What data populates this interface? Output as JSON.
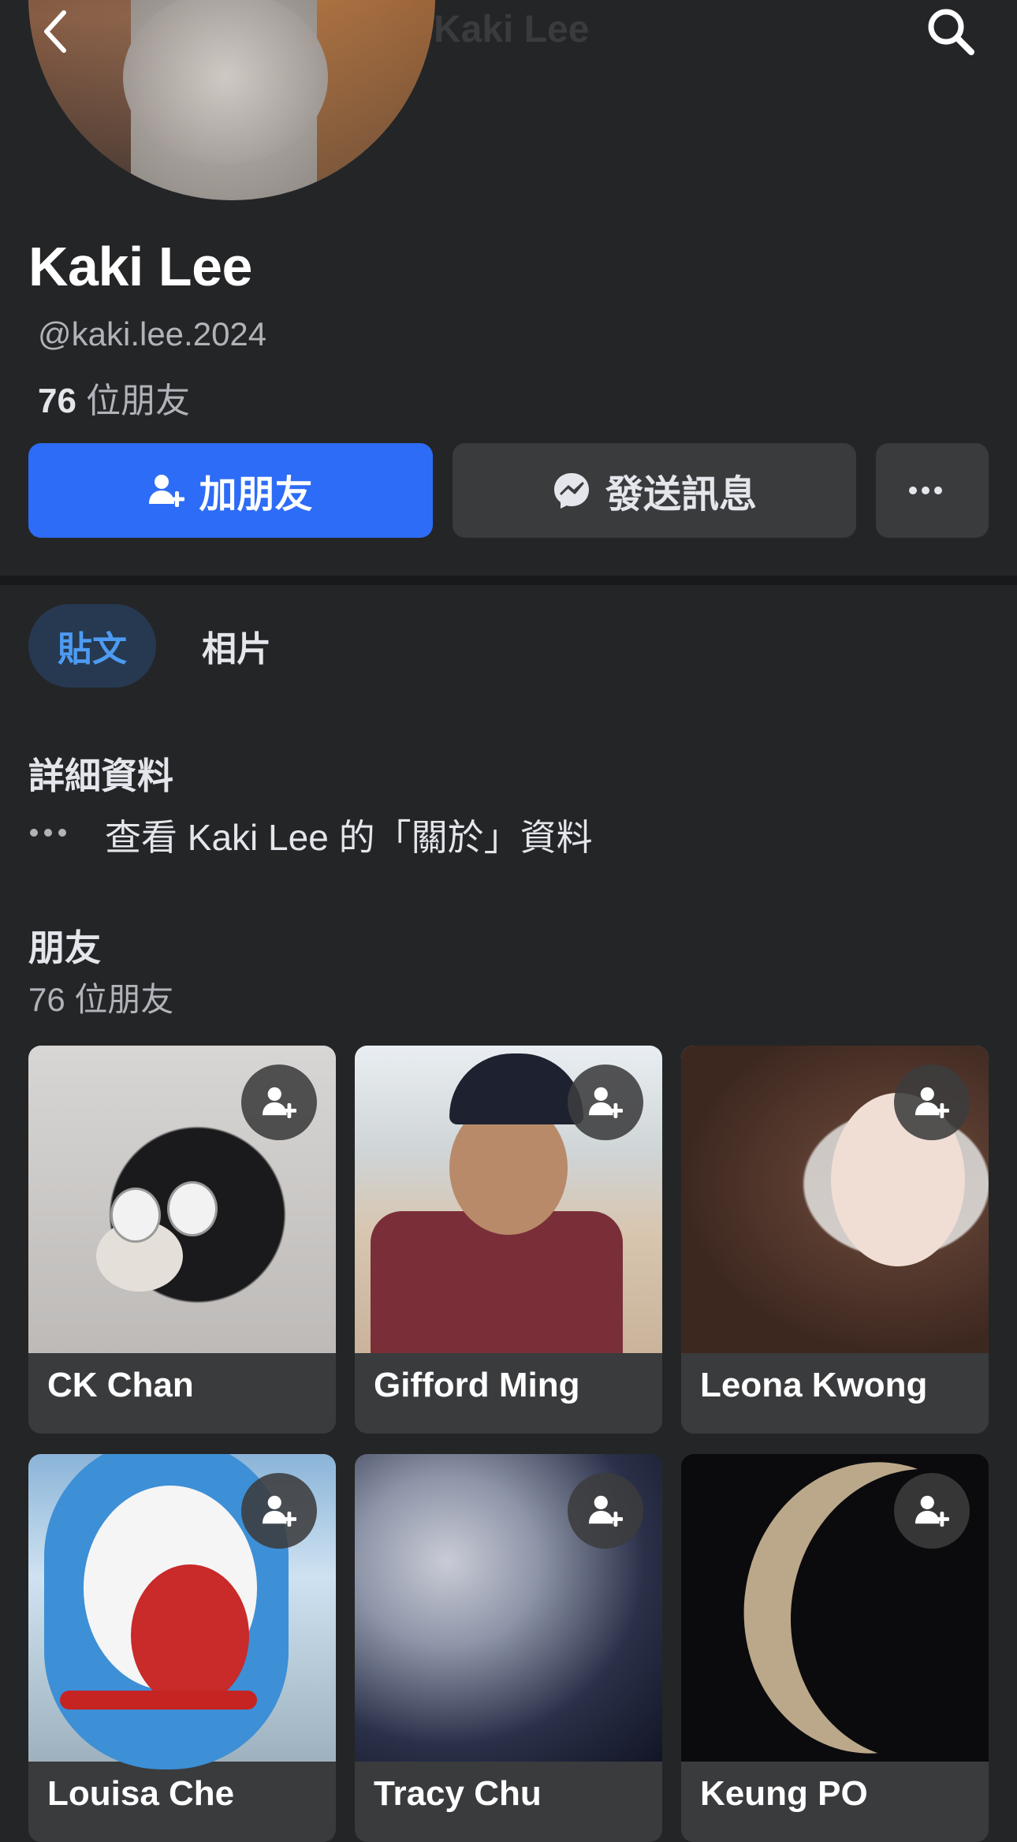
{
  "topbar": {
    "title": "Kaki Lee",
    "back_icon": "chevron-left-icon",
    "search_icon": "search-icon"
  },
  "profile": {
    "name": "Kaki Lee",
    "username": "@kaki.lee.2024",
    "friends_count": "76",
    "friends_suffix": " 位朋友"
  },
  "actions": {
    "add_friend": "加朋友",
    "message": "發送訊息",
    "more": "···"
  },
  "tabs": [
    {
      "label": "貼文",
      "active": true
    },
    {
      "label": "相片",
      "active": false
    }
  ],
  "details": {
    "title": "詳細資料",
    "about_link": "查看 Kaki Lee 的「關於」資料"
  },
  "friends": {
    "title": "朋友",
    "count_text": "76 位朋友",
    "items": [
      {
        "name": "CK Chan"
      },
      {
        "name": "Gifford Ming"
      },
      {
        "name": "Leona Kwong"
      },
      {
        "name": "Louisa Che"
      },
      {
        "name": "Tracy Chu"
      },
      {
        "name": "Keung PO"
      }
    ]
  },
  "colors": {
    "background": "#242527",
    "primary_button": "#2d6cf6",
    "secondary_button": "#3a3b3d",
    "active_tab_bg": "#263951",
    "active_tab_text": "#4d9bf2"
  }
}
